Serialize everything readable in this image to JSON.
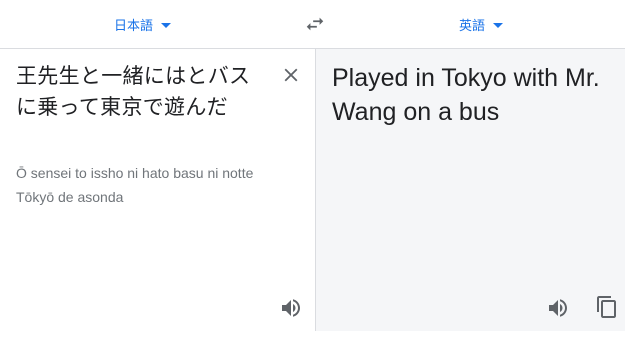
{
  "languages": {
    "source": "日本語",
    "target": "英語"
  },
  "source": {
    "text": "王先生と一緒にはとバスに乗って東京で遊んだ",
    "romanization": "Ō sensei to issho ni hato basu ni notte Tōkyō de asonda"
  },
  "target": {
    "text": "Played in Tokyo with Mr. Wang on a bus"
  },
  "icons": {
    "swap": "swap-horiz-icon",
    "clear": "close-icon",
    "speaker": "volume-icon",
    "copy": "copy-icon"
  },
  "colors": {
    "accent": "#1a73e8",
    "icon": "#5f6368",
    "target_bg": "#f5f6f8"
  }
}
